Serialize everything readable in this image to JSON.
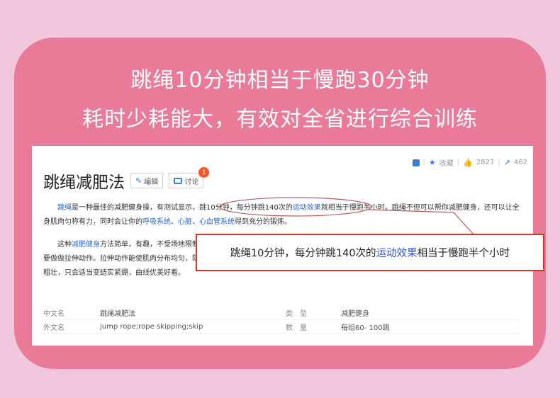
{
  "headline": {
    "line1": "跳绳10分钟相当于慢跑30分钟",
    "line2": "耗时少耗能大，有效对全省进行综合训练"
  },
  "entry": {
    "title": "跳绳减肥法",
    "edit_label": "编辑",
    "discuss_label": "讨论",
    "discuss_badge": "1",
    "stats": {
      "favorite_label": "收藏",
      "likes": "2827",
      "shares": "462"
    },
    "paragraph1": {
      "link1": "跳绳",
      "t1": "是一种最佳的减肥健身操，有测试显示，跳10分钟，每分钟跳140次的",
      "link2": "运动效果",
      "t2": "就相当于慢跑半小时。跳绳不但可以帮你减肥健身，还可以让全身肌肉匀称有力，同时会让你的",
      "link3": "呼吸系统",
      "t3": "、",
      "link4": "心脏",
      "t4": "、",
      "link5": "心血管系统",
      "t5": "得到充分的锻炼。"
    },
    "paragraph2": {
      "t1": "这种",
      "link1": "减肥健身",
      "t2": "方法简单，有趣，不受场地限制，跳绳可以达到减肥健身的目的，而且对女性尤为适宜。跳绳是一项很好的有氧运动。跳绳结束后，一定要做做拉伸动作。拉伸动作能使肌肉分布均匀，防止过度",
      "link2": "下腿",
      "t3": "的现象。跳绳之前做做热身和跳绳之后做做拉伸，就算长期坚持跳绳运动小腿肌肉也不会过分粗壮，只会适当变结实紧绷，曲线优美好看。"
    },
    "infobox": [
      {
        "k": "中文名",
        "v": "跳绳减肥法",
        "k2": "类　型",
        "v2": "减肥健身"
      },
      {
        "k": "外文名",
        "v": "jump rope;rope skipping;skip",
        "k2": "数　量",
        "v2": "每组60- 100跳"
      }
    ]
  },
  "callout": {
    "t1": "跳绳10分钟，每分钟跳140次的",
    "highlight": "运动效果",
    "t2": "相当于慢跑半个小时"
  },
  "colors": {
    "page_bg": "#f2c6dd",
    "card_bg": "#e97a98",
    "link": "#2f67c9",
    "callout_border": "#d9342a",
    "callout_highlight": "#2f54d9"
  }
}
